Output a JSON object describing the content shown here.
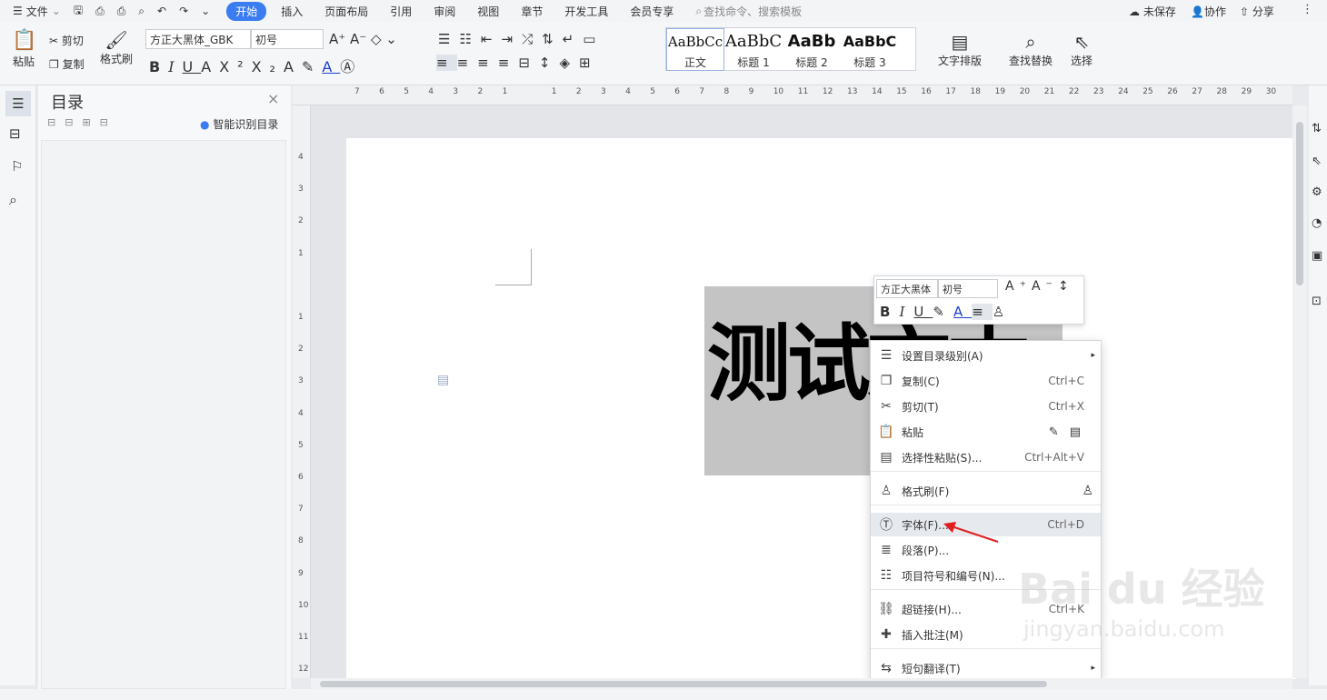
{
  "menubar": {
    "file": "文件",
    "tabs": [
      "开始",
      "插入",
      "页面布局",
      "引用",
      "审阅",
      "视图",
      "章节",
      "开发工具",
      "会员专享"
    ],
    "search_placeholder": "查找命令、搜索模板",
    "unsaved": "未保存",
    "collab": "协作",
    "share": "分享"
  },
  "ribbon": {
    "paste": "粘贴",
    "cut": "剪切",
    "copy": "复制",
    "format_painter": "格式刷",
    "font_name": "方正大黑体_GBK",
    "font_size": "初号",
    "styles": [
      {
        "preview": "AaBbCc",
        "name": "正文"
      },
      {
        "preview": "AaBbC",
        "name": "标题 1"
      },
      {
        "preview": "AaBb",
        "name": "标题 2"
      },
      {
        "preview": "AaBbC",
        "name": "标题 3"
      }
    ],
    "text_layout": "文字排版",
    "find_replace": "查找替换",
    "select": "选择"
  },
  "toc": {
    "title": "目录",
    "smart": "智能识别目录"
  },
  "ruler_top": [
    "7",
    "6",
    "5",
    "4",
    "3",
    "2",
    "1",
    "",
    "1",
    "2",
    "3",
    "4",
    "5",
    "6",
    "7",
    "8",
    "9",
    "10",
    "11",
    "12",
    "13",
    "14",
    "15",
    "16",
    "17",
    "18",
    "19",
    "20",
    "21",
    "22",
    "23",
    "24",
    "25",
    "26",
    "27",
    "28",
    "29",
    "30"
  ],
  "ruler_left": [
    "4",
    "3",
    "2",
    "1",
    "",
    "1",
    "2",
    "3",
    "4",
    "5",
    "6",
    "7",
    "8",
    "9",
    "10",
    "11",
    "12"
  ],
  "document": {
    "text": "测试文本"
  },
  "mini_toolbar": {
    "font": "方正大黑体",
    "size": "初号"
  },
  "context_menu": [
    {
      "icon": "toc-level-icon",
      "label": "设置目录级别(A)",
      "shortcut": "",
      "arrow": true
    },
    {
      "icon": "copy-icon",
      "label": "复制(C)",
      "shortcut": "Ctrl+C"
    },
    {
      "icon": "scissors-icon",
      "label": "剪切(T)",
      "shortcut": "Ctrl+X"
    },
    {
      "icon": "paste-icon",
      "label": "粘贴",
      "shortcut": ""
    },
    {
      "icon": "paste-special-icon",
      "label": "选择性粘贴(S)...",
      "shortcut": "Ctrl+Alt+V"
    },
    {
      "icon": "format-painter-icon",
      "label": "格式刷(F)",
      "shortcut": ""
    },
    {
      "icon": "font-icon",
      "label": "字体(F)...",
      "shortcut": "Ctrl+D"
    },
    {
      "icon": "paragraph-icon",
      "label": "段落(P)...",
      "shortcut": ""
    },
    {
      "icon": "list-icon",
      "label": "项目符号和编号(N)...",
      "shortcut": ""
    },
    {
      "icon": "link-icon",
      "label": "超链接(H)...",
      "shortcut": "Ctrl+K"
    },
    {
      "icon": "comment-icon",
      "label": "插入批注(M)",
      "shortcut": ""
    },
    {
      "icon": "translate-icon",
      "label": "短句翻译(T)",
      "shortcut": "",
      "arrow": true
    }
  ],
  "watermark": {
    "brand": "Bai du 经验",
    "url": "jingyan.baidu.com"
  },
  "colors": {
    "accent": "#3b7cf0",
    "selection": "#c4c4c4",
    "arrow": "#e02020"
  }
}
